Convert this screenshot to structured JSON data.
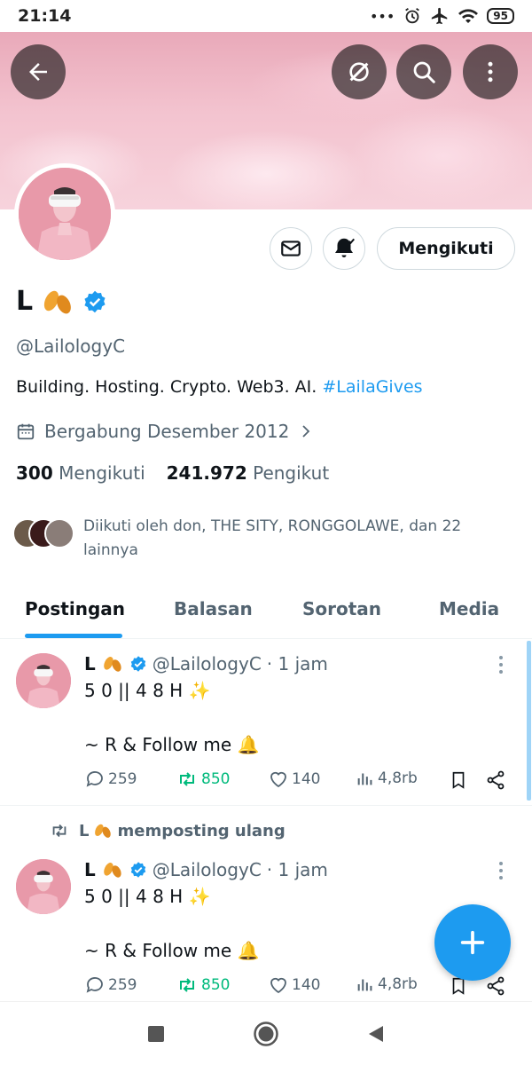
{
  "status_bar": {
    "time": "21:14",
    "battery": "95"
  },
  "profile": {
    "display_name": "L",
    "handle": "@LailologyC",
    "bio_text": "Building. Hosting. Crypto. Web3. AI.",
    "bio_hashtag": "#LailaGives",
    "joined": "Bergabung Desember 2012",
    "following_count": "300",
    "following_label": "Mengikuti",
    "followers_count": "241.972",
    "followers_label": "Pengikut",
    "followed_by": "Diikuti oleh don, THE SITY, RONGGOLAWE, dan 22 lainnya",
    "follow_button_label": "Mengikuti"
  },
  "tabs": [
    {
      "label": "Postingan",
      "active": true
    },
    {
      "label": "Balasan",
      "active": false
    },
    {
      "label": "Sorotan",
      "active": false
    },
    {
      "label": "Media",
      "active": false
    }
  ],
  "posts": [
    {
      "name": "L",
      "handle": "@LailologyC",
      "time": "· 1 jam",
      "line1": "5 0 || 4 8 H ✨",
      "line2": "~ R & Follow me 🔔",
      "replies": "259",
      "reposts": "850",
      "likes": "140",
      "views": "4,8rb"
    },
    {
      "repost_label": "memposting ulang",
      "name": "L",
      "handle": "@LailologyC",
      "time": "· 1 jam",
      "line1": "5 0 || 4 8 H ✨",
      "line2": "~ R & Follow me 🔔",
      "replies": "259",
      "reposts": "850",
      "likes": "140",
      "views": "4,8rb"
    }
  ],
  "icons": {
    "banner": [
      "back-arrow-icon",
      "grok-icon",
      "search-icon",
      "more-vertical-icon"
    ],
    "profile": [
      "message-icon",
      "bell-subscribed-icon",
      "verified-badge-icon",
      "calendar-icon",
      "chevron-right-icon"
    ],
    "post": [
      "reply-icon",
      "repost-icon",
      "like-icon",
      "views-icon",
      "bookmark-icon",
      "share-icon"
    ],
    "nav": [
      "recents-square-icon",
      "home-circle-icon",
      "back-triangle-icon"
    ]
  },
  "colors": {
    "accent": "#1d9bf0",
    "repost_green": "#00ba7c",
    "muted_text": "#536471",
    "banner_pink": "#f3c3cf"
  }
}
